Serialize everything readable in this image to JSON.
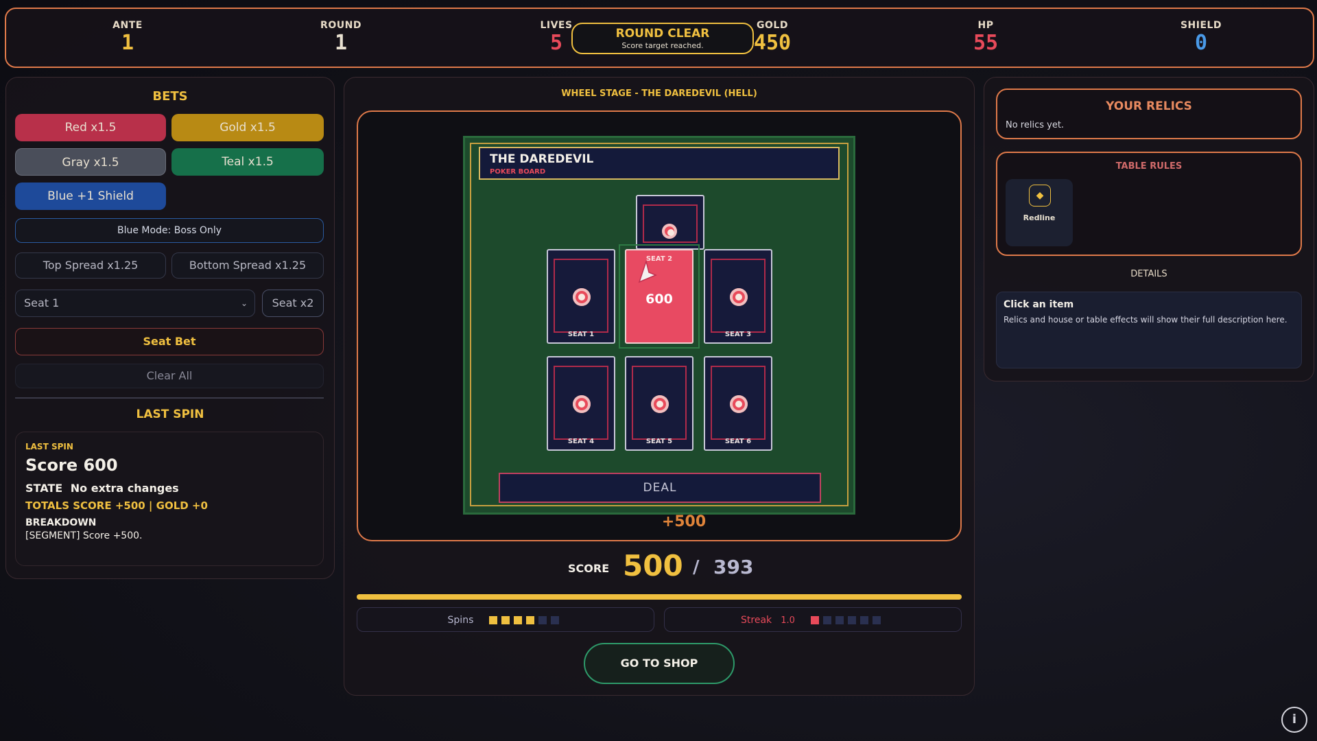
{
  "topbar": {
    "ante_label": "ANTE",
    "ante_value": "1",
    "round_label": "ROUND",
    "round_value": "1",
    "lives_label": "LIVES",
    "lives_value": "5",
    "gold_label": "GOLD",
    "gold_value": "450",
    "hp_label": "HP",
    "hp_value": "55",
    "shield_label": "SHIELD",
    "shield_value": "0",
    "banner_title": "ROUND CLEAR",
    "banner_subtitle": "Score target reached."
  },
  "bets": {
    "title": "BETS",
    "red": "Red x1.5",
    "gold": "Gold x1.5",
    "gray": "Gray x1.5",
    "teal": "Teal x1.5",
    "blue": "Blue +1 Shield",
    "blue_mode": "Blue Mode: Boss Only",
    "top_spread": "Top Spread x1.25",
    "bottom_spread": "Bottom Spread x1.25",
    "seat_select": "Seat 1",
    "seat_mult": "Seat x2",
    "seat_bet": "Seat Bet",
    "clear_all": "Clear All"
  },
  "last_spin": {
    "title": "LAST SPIN",
    "card_label": "LAST SPIN",
    "score": "Score 600",
    "state_label": "STATE",
    "state_value": "No extra changes",
    "totals": "TOTALS SCORE +500 | GOLD +0",
    "breakdown_label": "BREAKDOWN",
    "breakdown_value": "[SEGMENT] Score +500."
  },
  "stage": {
    "title": "WHEEL STAGE - THE DAREDEVIL (HELL)",
    "board_name": "THE DAREDEVIL",
    "board_sub": "POKER BOARD",
    "seats": [
      "SEAT 1",
      "SEAT 2",
      "SEAT 3",
      "SEAT 4",
      "SEAT 5",
      "SEAT 6"
    ],
    "seat2_value": "600",
    "deal": "DEAL",
    "gain": "+500"
  },
  "score": {
    "label": "SCORE",
    "value": "500",
    "separator": "/",
    "target": "393",
    "spins_label": "Spins",
    "spins_filled": 4,
    "spins_total": 6,
    "streak_label": "Streak",
    "streak_value": "1.0",
    "streak_filled": 1,
    "streak_total": 6,
    "go_shop": "GO TO SHOP"
  },
  "right": {
    "relics_title": "YOUR RELICS",
    "relics_empty": "No relics yet.",
    "rules_title": "TABLE RULES",
    "rule_name": "Redline",
    "details_title": "DETAILS",
    "details_heading": "Click an item",
    "details_text": "Relics and house or table effects will show their full description here."
  },
  "colors": {
    "accent": "#f0c040",
    "border": "#e07a4a",
    "lives": "#e84a5a",
    "shield": "#4a9ae8",
    "red_bet": "#b8304a",
    "gold_bet": "#b88a14",
    "gray_bet": "#4a4e5a",
    "teal_bet": "#16704a",
    "blue_bet": "#1e4a9a"
  },
  "icons": {
    "info": "info-icon",
    "rule": "diamond-icon",
    "cursor": "arrow-cursor-icon"
  }
}
